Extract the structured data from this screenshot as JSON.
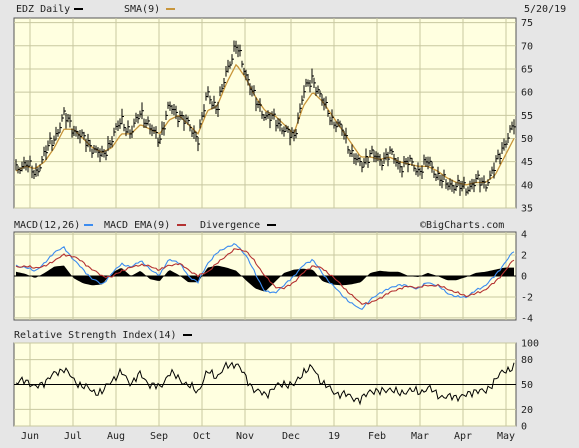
{
  "header": {
    "symbol_label": "EDZ Daily",
    "sma_label": "SMA(9)",
    "date": "5/20/19"
  },
  "macd_panel": {
    "macd_label": "MACD(12,26)",
    "ema_label": "MACD EMA(9)",
    "div_label": "Divergence",
    "watermark": "©BigCharts.com"
  },
  "rsi_panel": {
    "label": "Relative Strength Index(14)"
  },
  "colors": {
    "plot_bg": "#ffffe0",
    "frame_bg": "#e6e6e6",
    "grid": "#c8c8a0",
    "price_bar": "#000000",
    "sma": "#c8963c",
    "macd": "#3c8cf0",
    "macd_ema": "#b43232",
    "divergence": "#000000",
    "rsi": "#000000"
  },
  "chart_data": [
    {
      "type": "ohlc",
      "title": "EDZ Daily",
      "y_ticks": [
        35,
        40,
        45,
        50,
        55,
        60,
        65,
        70,
        75
      ],
      "ylim": [
        35,
        76
      ],
      "x_ticks": [
        "Jun",
        "Jul",
        "Aug",
        "Sep",
        "Oct",
        "Nov",
        "Dec",
        "19",
        "Feb",
        "Mar",
        "Apr",
        "May"
      ],
      "series": [
        {
          "name": "EDZ Daily",
          "close_anchors": [
            43,
            45,
            42,
            47,
            50,
            55,
            52,
            50,
            48,
            46,
            50,
            54,
            51,
            56,
            52,
            50,
            57,
            55,
            53,
            50,
            60,
            56,
            65,
            70,
            64,
            58,
            55,
            54,
            52,
            50,
            60,
            63,
            58,
            54,
            52,
            47,
            44,
            47,
            45,
            47,
            44,
            45,
            43,
            45,
            42,
            40,
            40,
            39,
            41,
            40,
            44,
            49,
            53
          ]
        },
        {
          "name": "SMA(9)",
          "anchors": [
            43,
            44,
            43.5,
            45,
            48,
            52,
            52,
            50,
            48,
            47,
            48,
            51,
            51,
            53,
            52,
            51,
            54,
            55,
            53,
            51,
            56,
            57,
            62,
            66,
            63,
            59,
            56,
            55,
            53,
            51,
            57,
            60,
            58,
            55,
            52,
            49,
            46,
            46,
            45.5,
            46,
            45,
            44.5,
            44,
            44,
            43,
            41.5,
            40.5,
            40,
            40.5,
            40.5,
            42,
            46,
            50
          ]
        }
      ]
    },
    {
      "type": "line",
      "title": "MACD(12,26)",
      "y_ticks": [
        4,
        2,
        0,
        -2,
        -4
      ],
      "ylim": [
        -4.2,
        4.2
      ],
      "series": [
        {
          "name": "MACD(12,26)",
          "anchors": [
            1.0,
            0.8,
            0.5,
            1.2,
            2.3,
            2.7,
            1.6,
            0.6,
            -0.3,
            -0.8,
            0.2,
            1.2,
            0.8,
            1.5,
            0.6,
            0.1,
            1.6,
            1.3,
            0.0,
            -0.6,
            1.2,
            2.2,
            2.8,
            3.0,
            2.0,
            0.2,
            -1.5,
            -1.6,
            -0.9,
            0.0,
            1.0,
            1.6,
            0.2,
            -0.8,
            -1.8,
            -2.6,
            -3.2,
            -2.3,
            -1.6,
            -1.2,
            -0.8,
            -1.0,
            -1.2,
            -0.6,
            -0.9,
            -1.6,
            -2.0,
            -2.0,
            -1.4,
            -0.9,
            0.0,
            1.2,
            2.4
          ]
        },
        {
          "name": "MACD EMA(9)",
          "anchors": [
            0.9,
            0.9,
            0.8,
            0.9,
            1.5,
            2.0,
            1.9,
            1.3,
            0.6,
            0.0,
            -0.1,
            0.5,
            0.8,
            1.1,
            0.9,
            0.6,
            1.0,
            1.2,
            0.6,
            0.0,
            0.4,
            1.2,
            2.0,
            2.6,
            2.4,
            1.3,
            0.0,
            -1.0,
            -1.2,
            -0.6,
            0.3,
            1.0,
            0.7,
            0.0,
            -0.9,
            -1.8,
            -2.6,
            -2.6,
            -2.1,
            -1.6,
            -1.2,
            -1.0,
            -1.1,
            -0.9,
            -0.9,
            -1.2,
            -1.6,
            -1.9,
            -1.7,
            -1.3,
            -0.6,
            0.4,
            1.6
          ]
        },
        {
          "name": "Divergence",
          "anchors": [
            0.4,
            0.2,
            -0.2,
            0.3,
            0.9,
            1.0,
            -0.2,
            -0.7,
            -0.9,
            -0.8,
            0.3,
            0.8,
            0.0,
            0.5,
            -0.3,
            -0.5,
            0.6,
            0.1,
            -0.6,
            -0.6,
            0.8,
            1.0,
            0.8,
            0.5,
            -0.4,
            -1.2,
            -1.5,
            -0.6,
            0.3,
            0.6,
            0.7,
            0.6,
            -0.5,
            -0.8,
            -0.9,
            -0.8,
            -0.6,
            0.3,
            0.5,
            0.4,
            0.4,
            0.0,
            -0.1,
            0.3,
            0.0,
            -0.4,
            -0.4,
            -0.1,
            0.3,
            0.4,
            0.6,
            0.8,
            0.8
          ]
        }
      ]
    },
    {
      "type": "line",
      "title": "Relative Strength Index(14)",
      "y_ticks": [
        100,
        80,
        50,
        20,
        0
      ],
      "ylim": [
        0,
        100
      ],
      "reference_line": 50,
      "series": [
        {
          "name": "Relative Strength Index(14)",
          "anchors": [
            50,
            57,
            45,
            54,
            62,
            70,
            55,
            48,
            42,
            40,
            56,
            64,
            52,
            62,
            50,
            46,
            64,
            58,
            48,
            42,
            65,
            60,
            72,
            76,
            58,
            42,
            38,
            46,
            52,
            48,
            66,
            70,
            52,
            42,
            38,
            36,
            30,
            44,
            40,
            46,
            38,
            44,
            40,
            46,
            38,
            34,
            36,
            36,
            44,
            40,
            56,
            66,
            72
          ]
        }
      ]
    }
  ]
}
